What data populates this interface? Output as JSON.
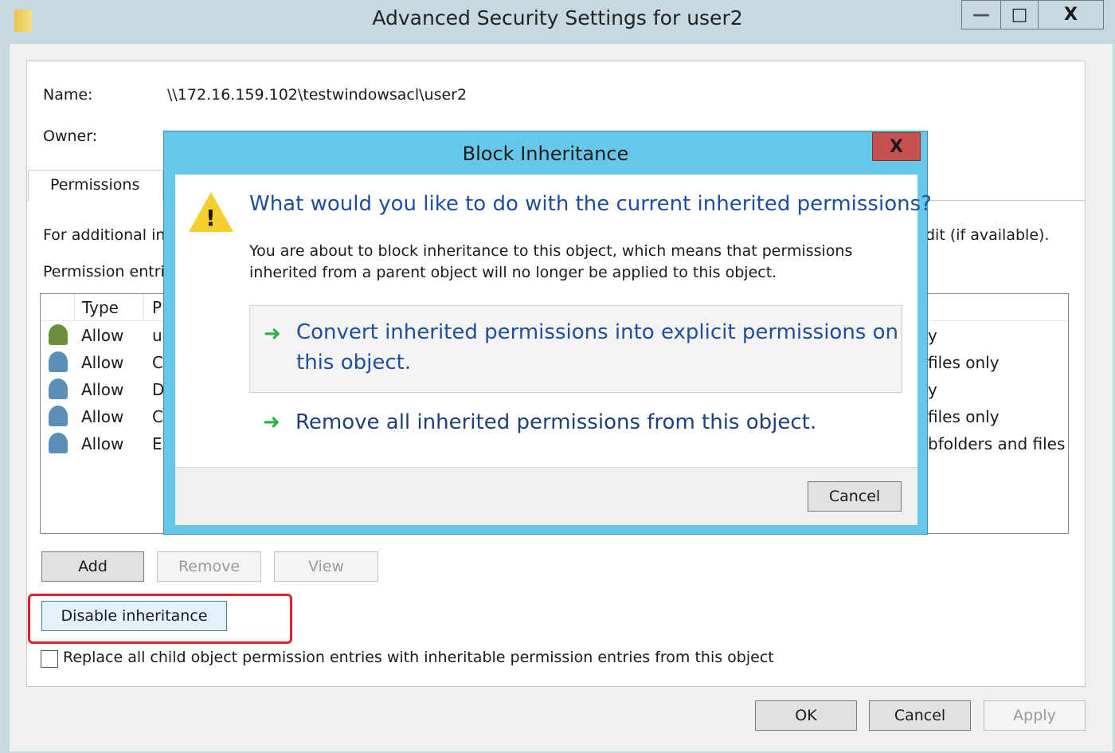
{
  "window": {
    "title": "Advanced Security Settings for user2",
    "minimize": "—",
    "maximize": "□",
    "close": "X"
  },
  "main": {
    "name_label": "Name:",
    "name_value": "\\\\172.16.159.102\\testwindowsacl\\user2",
    "owner_label": "Owner:",
    "tab": "Permissions",
    "info_prefix": "For additional in",
    "info_suffix": "dit (if available).",
    "entries_label": "Permission entri",
    "columns": [
      "Type",
      "P"
    ],
    "rows": [
      {
        "type": "Allow",
        "p": "u",
        "end": "y",
        "icon": "user-icon"
      },
      {
        "type": "Allow",
        "p": "C",
        "end": "files only",
        "icon": "group-icon"
      },
      {
        "type": "Allow",
        "p": "D",
        "end": "y",
        "icon": "group-icon"
      },
      {
        "type": "Allow",
        "p": "C",
        "end": "files only",
        "icon": "group-icon"
      },
      {
        "type": "Allow",
        "p": "E",
        "end": "bfolders and files",
        "icon": "group-icon"
      }
    ],
    "add": "Add",
    "remove": "Remove",
    "view": "View",
    "disable_inheritance": "Disable inheritance",
    "replace_checkbox": "Replace all child object permission entries with inheritable permission entries from this object",
    "replace_checked": false,
    "ok": "OK",
    "cancel": "Cancel",
    "apply": "Apply",
    "highlight_color": "#e0202a"
  },
  "dialog": {
    "title": "Block Inheritance",
    "close": "X",
    "question": "What would you like to do with the current inherited permissions?",
    "body_line1": "You are about to block inheritance to this object, which means that permissions",
    "body_line2": "inherited from a parent object will no longer be applied to this object.",
    "option1_line1": "Convert inherited permissions into explicit permissions on",
    "option1_line2": "this object.",
    "option2": "Remove all inherited permissions from this object.",
    "cancel": "Cancel",
    "icon": "warning-icon"
  }
}
